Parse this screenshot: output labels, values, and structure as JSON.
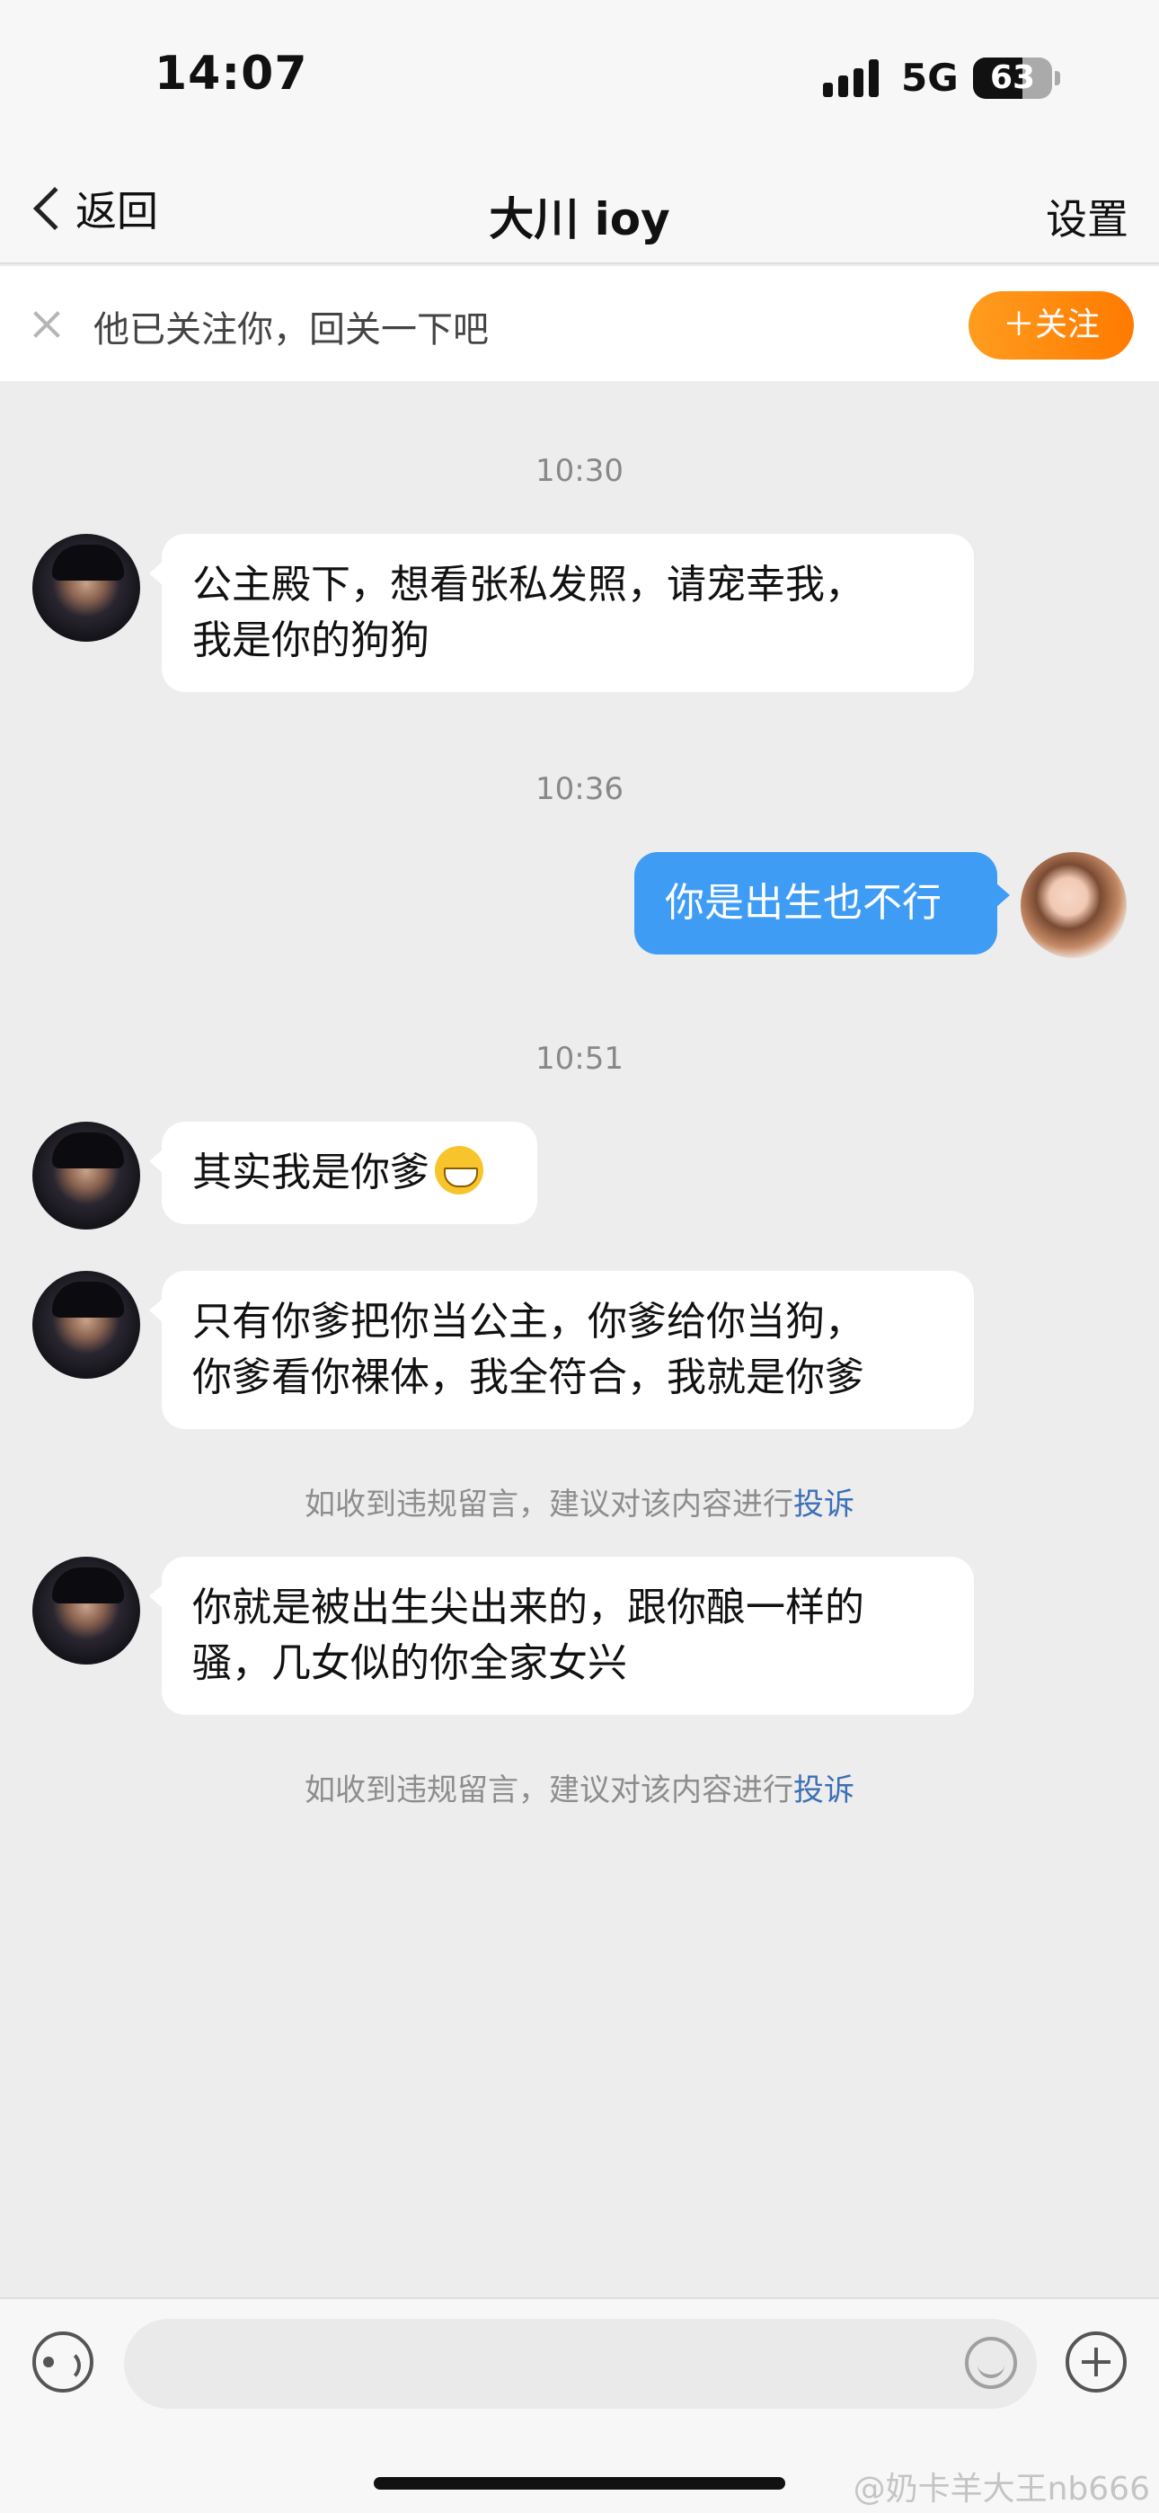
{
  "status_bar": {
    "time": "14:07",
    "network": "5G",
    "battery": "63",
    "battery_level": 0.63
  },
  "nav": {
    "back_label": "返回",
    "title": "大川 ioy",
    "settings_label": "设置"
  },
  "follow_bar": {
    "text": "他已关注你，回关一下吧",
    "button_label": "＋关注"
  },
  "messages": [
    {
      "time": "10:30"
    },
    {
      "from": "them",
      "text_line1": "公主殿下，想看张私发照，请宠幸我，",
      "text_line2": "我是你的狗狗"
    },
    {
      "time": "10:36"
    },
    {
      "from": "me",
      "text": "你是出生也不行"
    },
    {
      "time": "10:51"
    },
    {
      "from": "them",
      "text": "其实我是你爹",
      "emoji": "grinning-emoji"
    },
    {
      "from": "them",
      "text_line1": "只有你爹把你当公主，你爹给你当狗，",
      "text_line2": "你爹看你裸体，我全符合，我就是你爹"
    },
    {
      "notice": "如收到违规留言，建议对该内容进行",
      "link": "投诉"
    },
    {
      "from": "them",
      "text_line1": "你就是被出生尖出来的，跟你酿一样的",
      "text_line2": "骚，几女似的你全家女兴"
    },
    {
      "notice": "如收到违规留言，建议对该内容进行",
      "link": "投诉"
    }
  ],
  "input_bar": {
    "placeholder": "",
    "icons": [
      "voice-icon",
      "emoji-icon",
      "plus-icon"
    ]
  },
  "watermark": "@奶卡羊大王nb666",
  "colors": {
    "follow_button": "#ff8a00",
    "outgoing_bubble": "#3f9cf5",
    "report_link": "#3d6fb6",
    "chat_background": "#ededed"
  }
}
